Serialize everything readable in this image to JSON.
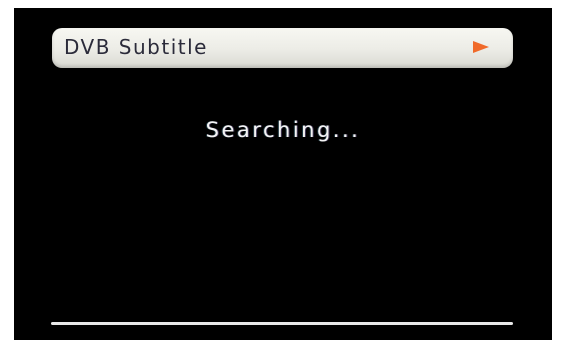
{
  "menu": {
    "label": "DVB Subtitle",
    "arrow_icon": "arrow-right-icon",
    "arrow_color": "#f06a2a"
  },
  "status": {
    "text": "Searching..."
  },
  "colors": {
    "background": "#000000",
    "menu_bar": "#ecece6",
    "text": "#f4f4f4"
  }
}
